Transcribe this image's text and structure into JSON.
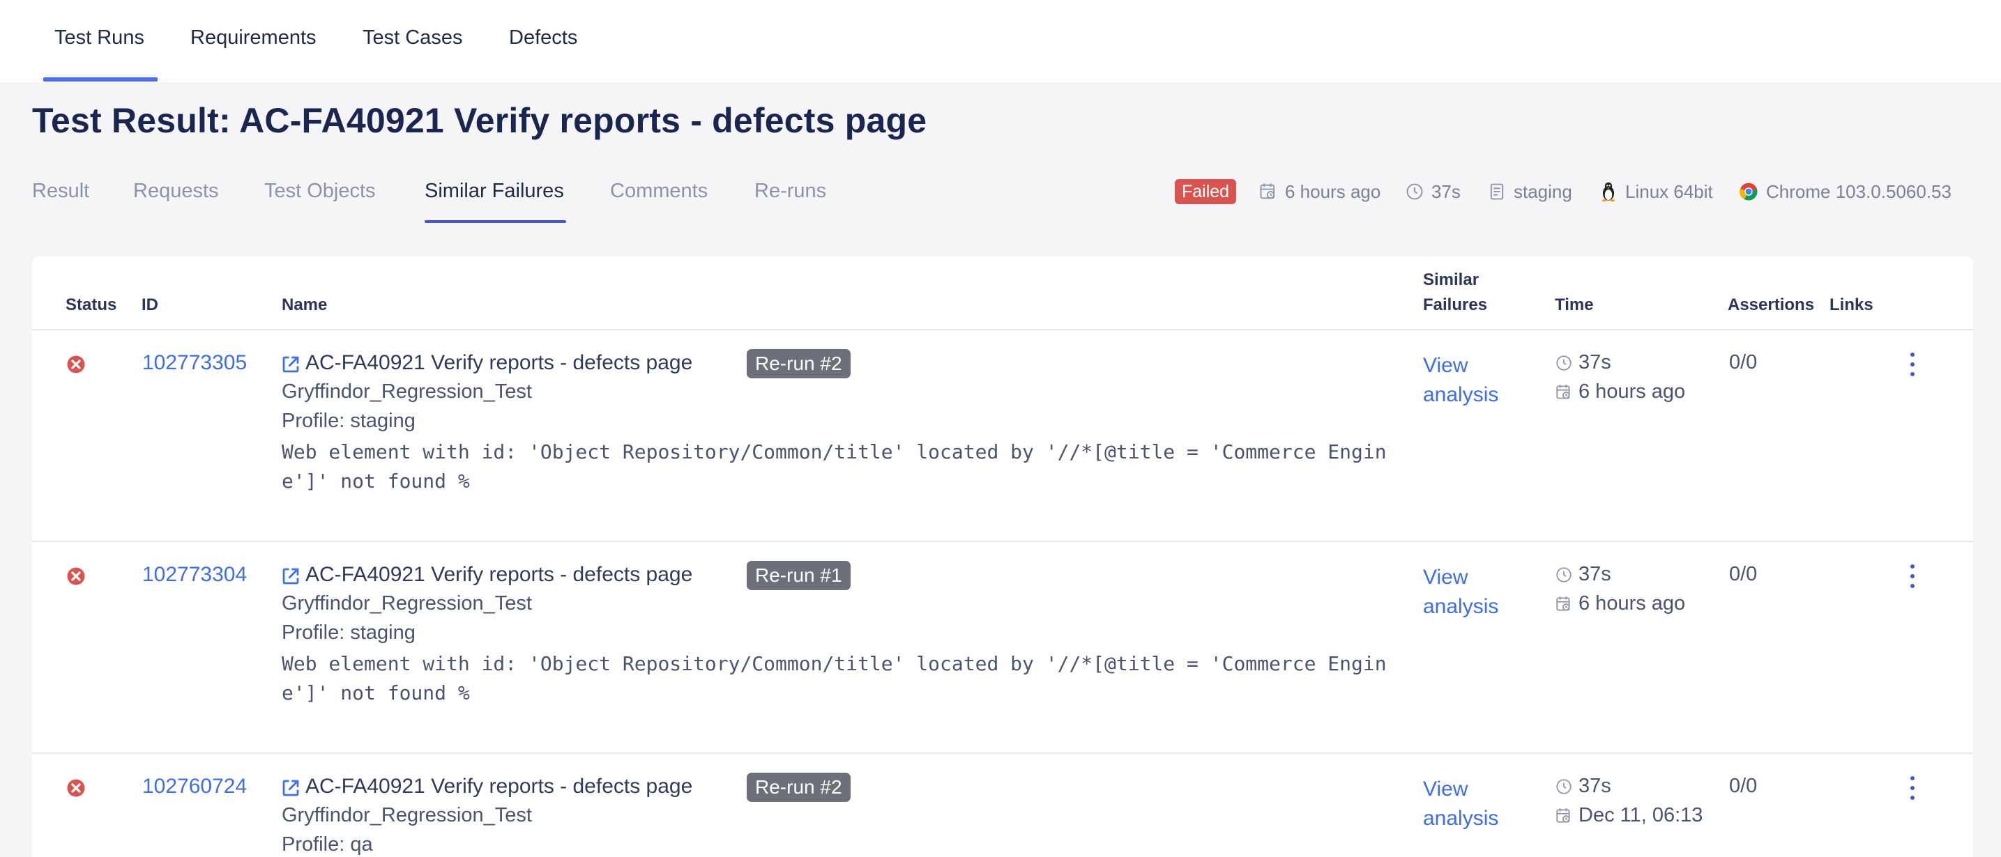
{
  "topnav": {
    "items": [
      {
        "label": "Test Runs"
      },
      {
        "label": "Requirements"
      },
      {
        "label": "Test Cases"
      },
      {
        "label": "Defects"
      }
    ]
  },
  "page": {
    "title": "Test Result: AC-FA40921 Verify reports - defects page"
  },
  "subtabs": [
    {
      "label": "Result"
    },
    {
      "label": "Requests"
    },
    {
      "label": "Test Objects"
    },
    {
      "label": "Similar Failures"
    },
    {
      "label": "Comments"
    },
    {
      "label": "Re-runs"
    }
  ],
  "meta": {
    "status": "Failed",
    "started": "6 hours ago",
    "duration": "37s",
    "profile": "staging",
    "os": "Linux 64bit",
    "browser": "Chrome 103.0.5060.53"
  },
  "colors": {
    "accent": "#4a6cf0",
    "link": "#3e6fe0",
    "failed": "#d9534f",
    "rerun_badge": "#6b7079"
  },
  "table": {
    "headers": {
      "status": "Status",
      "id": "ID",
      "name": "Name",
      "similar_1": "Similar",
      "similar_2": "Failures",
      "time": "Time",
      "assertions": "Assertions",
      "links": "Links"
    },
    "rows": [
      {
        "id": "102773305",
        "name": "AC-FA40921 Verify reports - defects page",
        "rerun": "Re-run #2",
        "suite": "Gryffindor_Regression_Test",
        "profile": "Profile: staging",
        "error": "Web element with id: 'Object Repository/Common/title' located by '//*[@title = 'Commerce Engine']' not found %",
        "analysis_1": "View",
        "analysis_2": "analysis",
        "duration": "37s",
        "when": "6 hours ago",
        "assertions": "0/0"
      },
      {
        "id": "102773304",
        "name": "AC-FA40921 Verify reports - defects page",
        "rerun": "Re-run #1",
        "suite": "Gryffindor_Regression_Test",
        "profile": "Profile: staging",
        "error": "Web element with id: 'Object Repository/Common/title' located by '//*[@title = 'Commerce Engine']' not found %",
        "analysis_1": "View",
        "analysis_2": "analysis",
        "duration": "37s",
        "when": "6 hours ago",
        "assertions": "0/0"
      },
      {
        "id": "102760724",
        "name": "AC-FA40921 Verify reports - defects page",
        "rerun": "Re-run #2",
        "suite": "Gryffindor_Regression_Test",
        "profile": "Profile: qa",
        "error": "",
        "analysis_1": "View",
        "analysis_2": "analysis",
        "duration": "37s",
        "when": "Dec 11, 06:13",
        "assertions": "0/0"
      }
    ]
  }
}
